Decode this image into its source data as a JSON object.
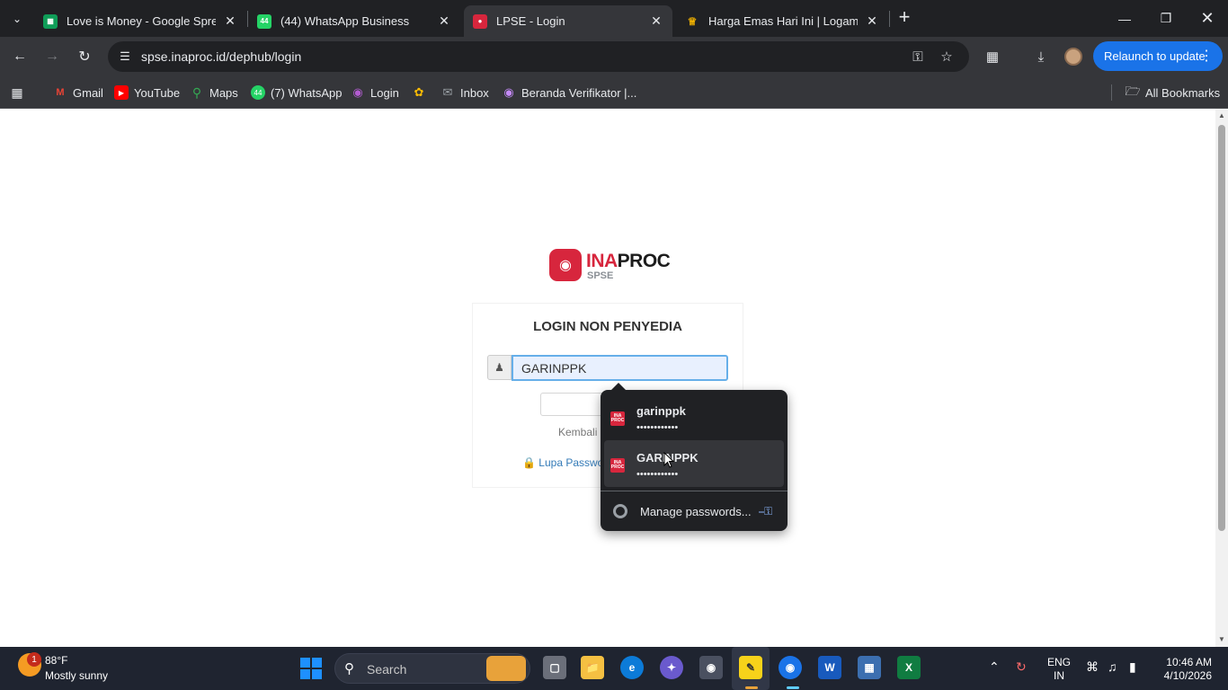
{
  "browser": {
    "tabs": [
      {
        "title": "Love is Money - Google Spreadsheet",
        "icon": "sheets-icon",
        "color": "#0f9d58"
      },
      {
        "title": "(44) WhatsApp Business",
        "icon": "whatsapp-icon",
        "color": "#25d366",
        "badge": "44"
      },
      {
        "title": "LPSE - Login",
        "icon": "inaproc-icon",
        "color": "#d7263d",
        "active": true
      },
      {
        "title": "Harga Emas Hari Ini | Logam Mulia",
        "icon": "gold-icon",
        "color": "#f4b400"
      }
    ],
    "url": "spse.inaproc.id/dephub/login",
    "relaunch_label": "Relaunch to update",
    "bookmarks": [
      {
        "label": "Gmail",
        "icon": "gmail-icon"
      },
      {
        "label": "YouTube",
        "icon": "youtube-icon"
      },
      {
        "label": "Maps",
        "icon": "maps-icon"
      },
      {
        "label": "(7) WhatsApp",
        "icon": "whatsapp-icon",
        "badge": "44"
      },
      {
        "label": "Login",
        "icon": "login-icon"
      },
      {
        "label": "",
        "icon": "pinwheel-icon"
      },
      {
        "label": "Inbox",
        "icon": "mail-icon"
      },
      {
        "label": "Beranda Verifikator |...",
        "icon": "globe-icon"
      }
    ],
    "all_bookmarks_label": "All Bookmarks"
  },
  "page": {
    "logo": {
      "ina": "INA",
      "proc": "PROC",
      "sub": "SPSE"
    },
    "card_title": "LOGIN NON PENYEDIA",
    "username_value": "GARINPPK",
    "login_button": "L",
    "kembali_link": "Kembali",
    "lupa_link": "Lupa Passwo"
  },
  "password_popup": {
    "items": [
      {
        "username": "garinppk",
        "mask": "••••••••••••"
      },
      {
        "username": "GARINPPK",
        "mask": "••••••••••••"
      }
    ],
    "fav_text": "INA PROC",
    "manage_label": "Manage passwords..."
  },
  "taskbar": {
    "weather_badge": "1",
    "temperature": "88°F",
    "condition": "Mostly sunny",
    "search_placeholder": "Search",
    "language_line1": "ENG",
    "language_line2": "IN",
    "time": "10:46 AM",
    "date": "4/10/2026"
  },
  "colors": {
    "accent": "#1a73e8",
    "brand_red": "#d7263d"
  }
}
